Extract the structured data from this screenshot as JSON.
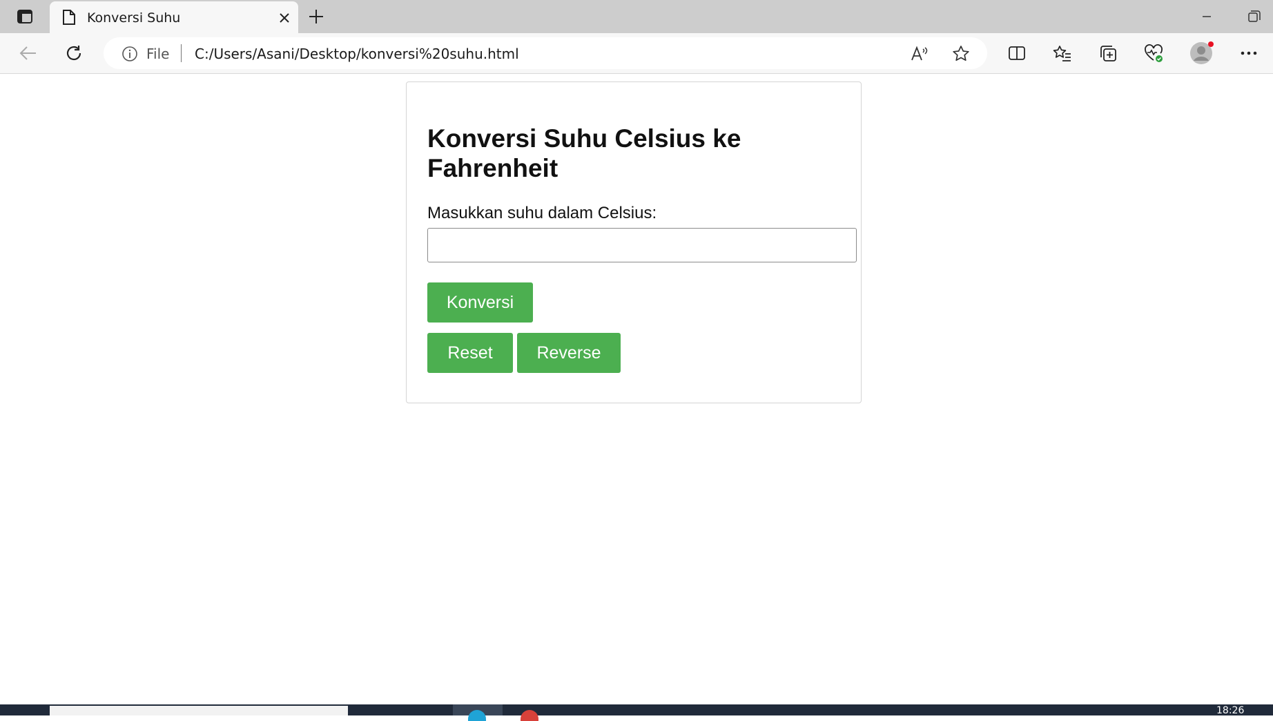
{
  "browser": {
    "tab_title": "Konversi Suhu",
    "address_scheme": "File",
    "address_url": "C:/Users/Asani/Desktop/konversi%20suhu.html"
  },
  "page": {
    "heading": "Konversi Suhu Celsius ke Fahrenheit",
    "input_label": "Masukkan suhu dalam Celsius:",
    "input_value": "",
    "buttons": {
      "konversi": "Konversi",
      "reset": "Reset",
      "reverse": "Reverse"
    },
    "button_color": "#4caf50"
  },
  "taskbar": {
    "clock": "18:26"
  },
  "icons": [
    "sidebar-toggle-icon",
    "document-icon",
    "close-icon",
    "plus-icon",
    "minimize-icon",
    "restore-icon",
    "back-arrow-icon",
    "refresh-icon",
    "info-icon",
    "read-aloud-icon",
    "favorite-star-icon",
    "split-screen-icon",
    "favorites-icon",
    "collections-icon",
    "browser-essentials-icon",
    "profile-avatar-icon",
    "more-menu-icon"
  ]
}
